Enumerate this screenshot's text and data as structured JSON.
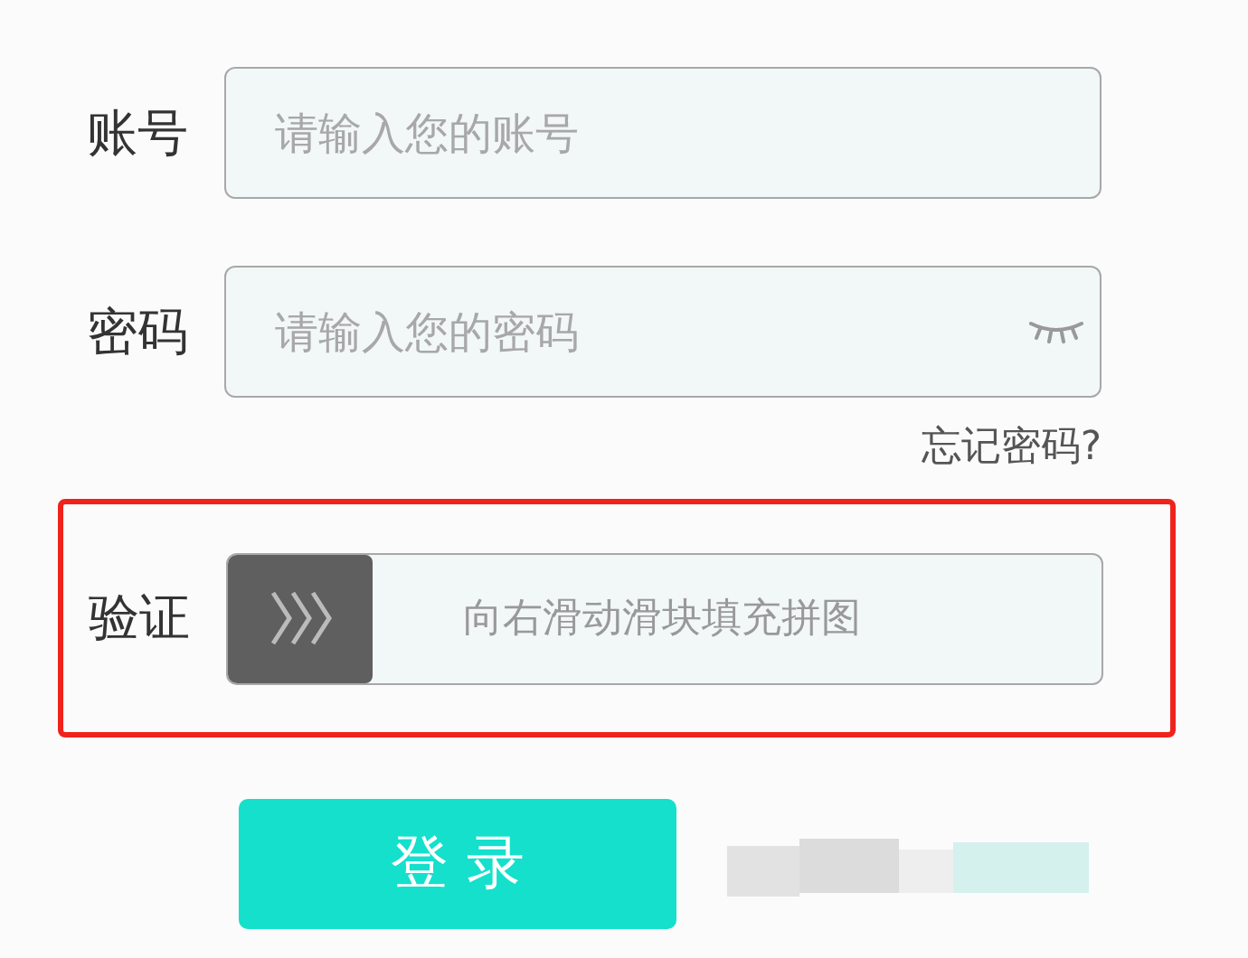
{
  "account": {
    "label": "账号",
    "placeholder": "请输入您的账号"
  },
  "password": {
    "label": "密码",
    "placeholder": "请输入您的密码",
    "visible": false
  },
  "forgot_link": "忘记密码?",
  "verify": {
    "label": "验证",
    "hint": "向右滑动滑块填充拼图",
    "level": 0,
    "highlighted": true
  },
  "login_button": "登 录"
}
